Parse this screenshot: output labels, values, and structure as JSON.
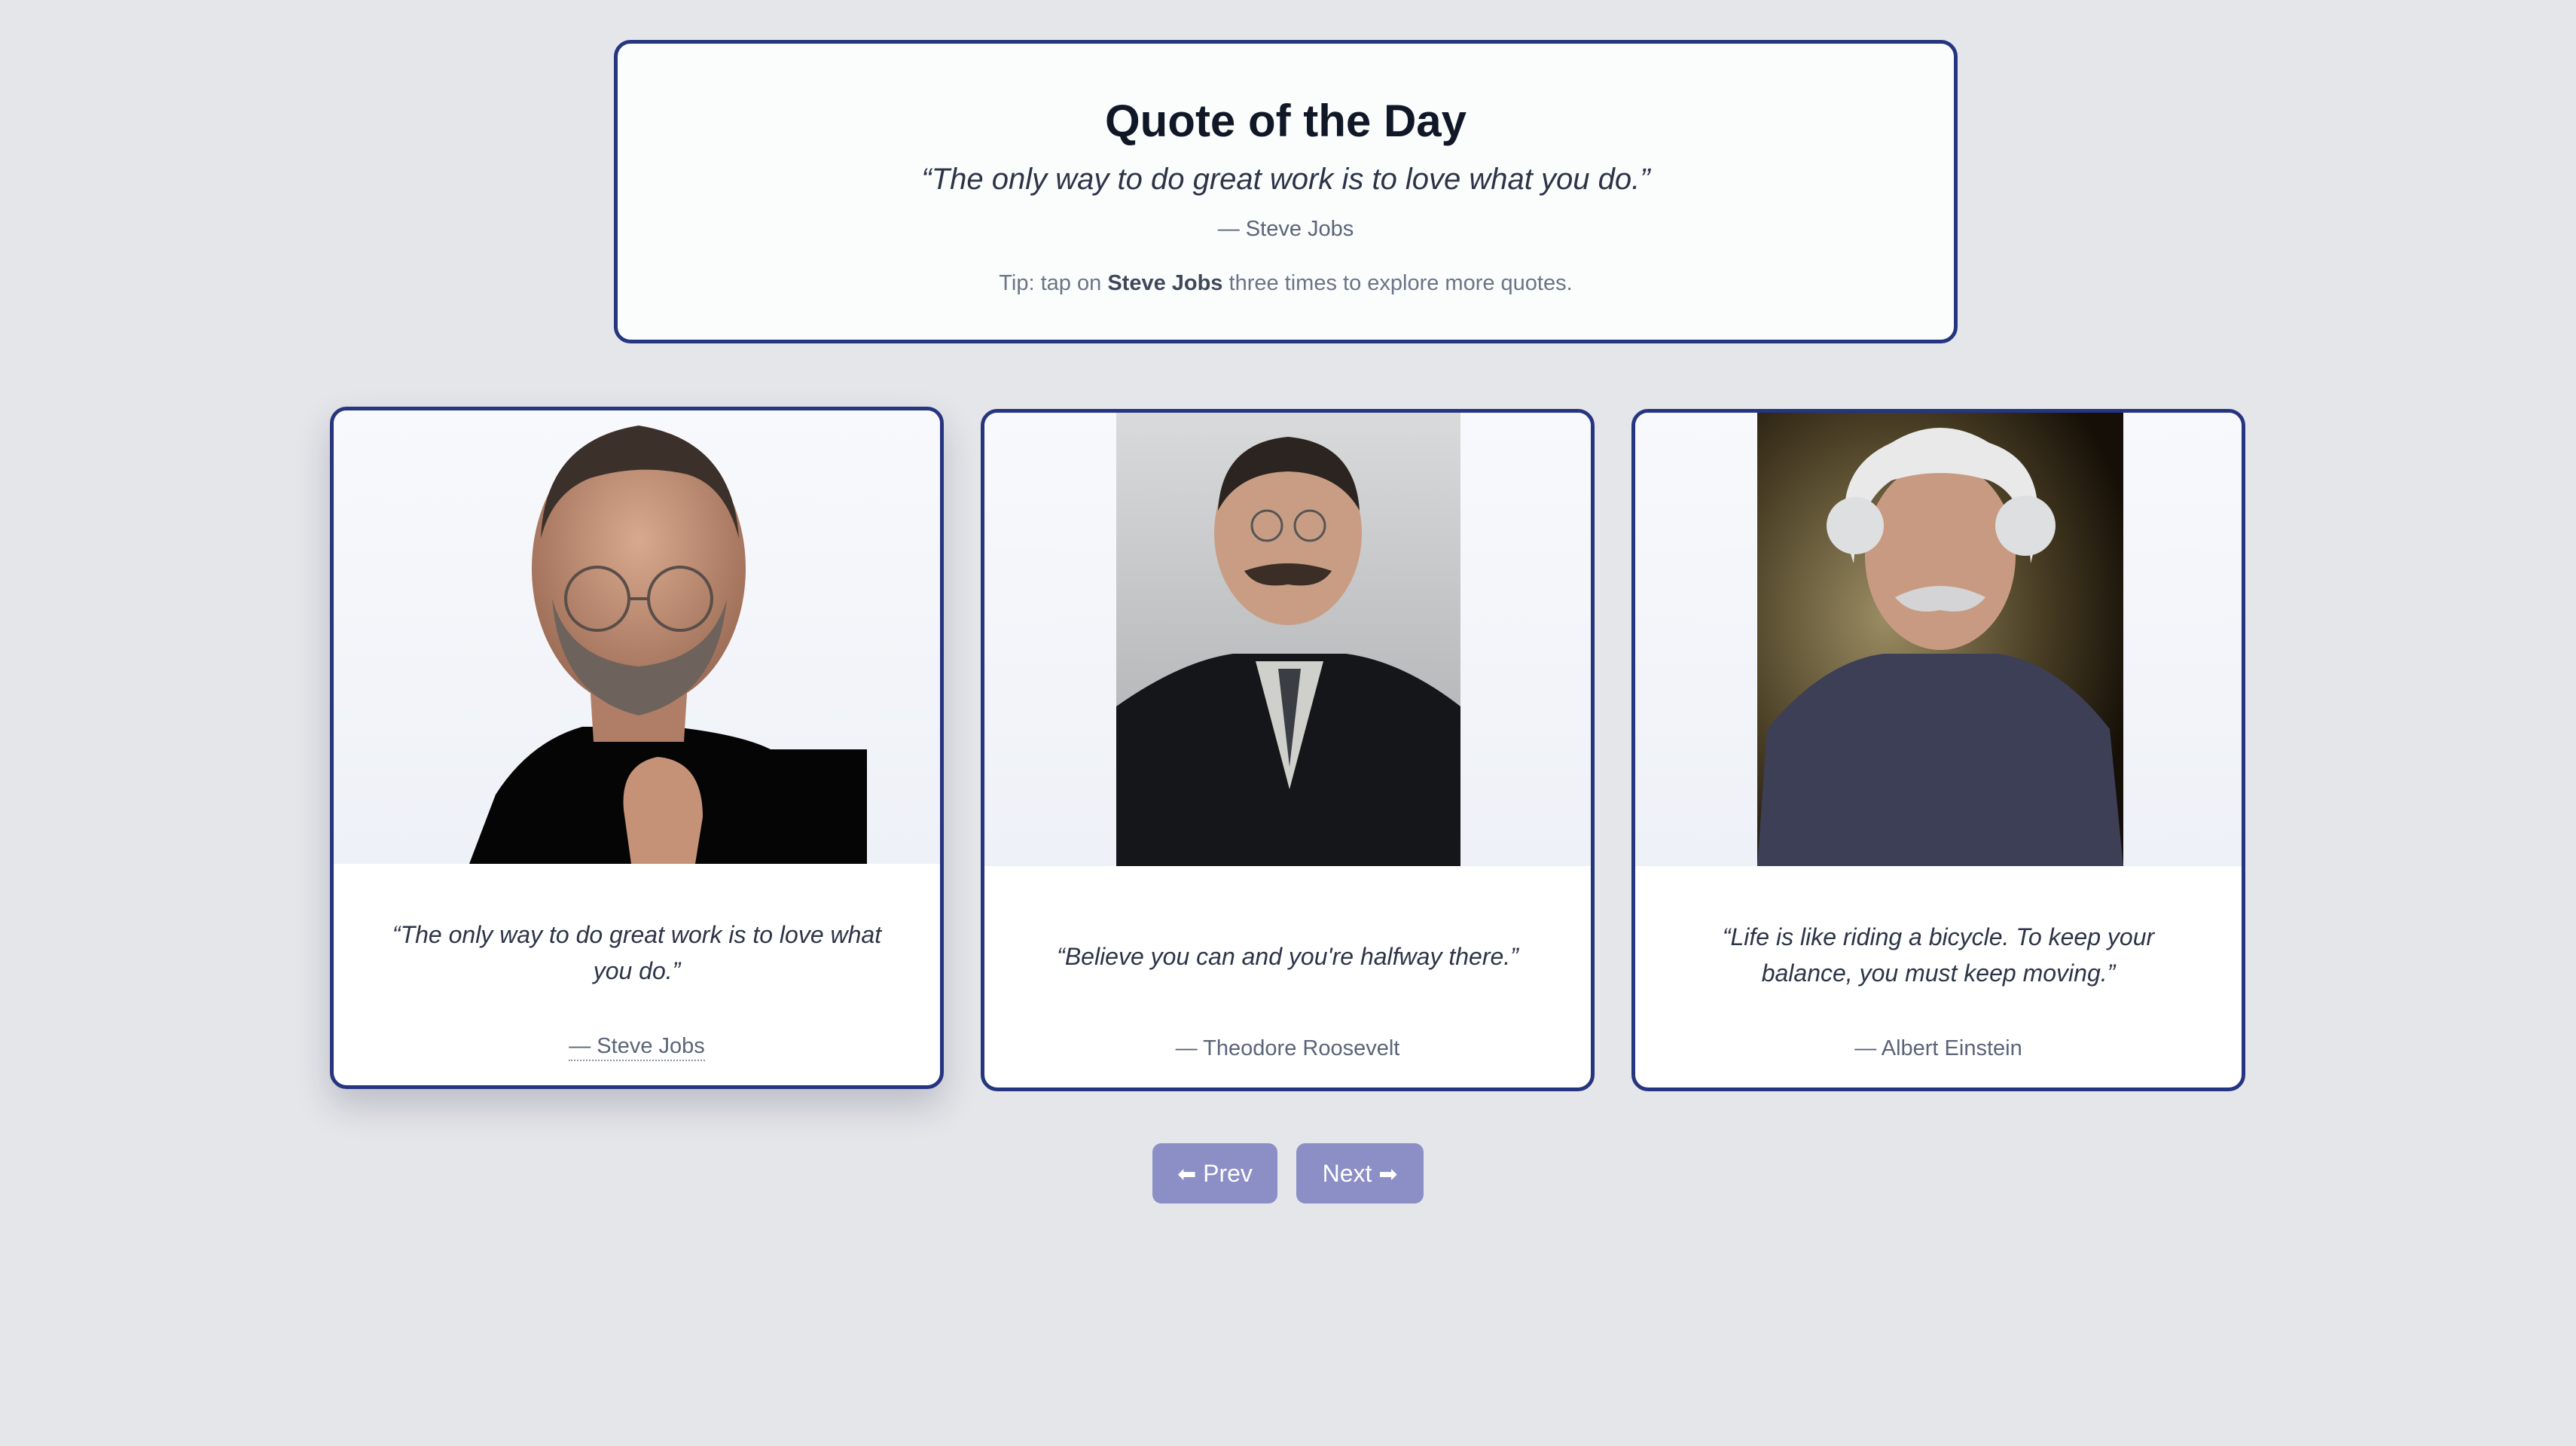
{
  "header": {
    "title": "Quote of the Day",
    "quote": "“The only way to do great work is to love what you do.”",
    "author": "— Steve Jobs",
    "tip_prefix": "Tip: tap on ",
    "tip_name": "Steve Jobs",
    "tip_suffix": " three times to explore more quotes."
  },
  "cards": [
    {
      "quote": "“The only way to do great work is to love what you do.”",
      "author": "— Steve Jobs",
      "photo": "steve-jobs-portrait"
    },
    {
      "quote": "“Believe you can and you're halfway there.”",
      "author": "— Theodore Roosevelt",
      "photo": "theodore-roosevelt-portrait"
    },
    {
      "quote": "“Life is like riding a bicycle. To keep your balance, you must keep moving.”",
      "author": "— Albert Einstein",
      "photo": "albert-einstein-portrait"
    }
  ],
  "nav": {
    "prev_arrow": "⬅",
    "prev_label": "Prev",
    "next_label": "Next",
    "next_arrow": "➡"
  },
  "colors": {
    "background": "#e5e6ea",
    "card_border": "#26357f",
    "button": "#8b8fc6"
  }
}
